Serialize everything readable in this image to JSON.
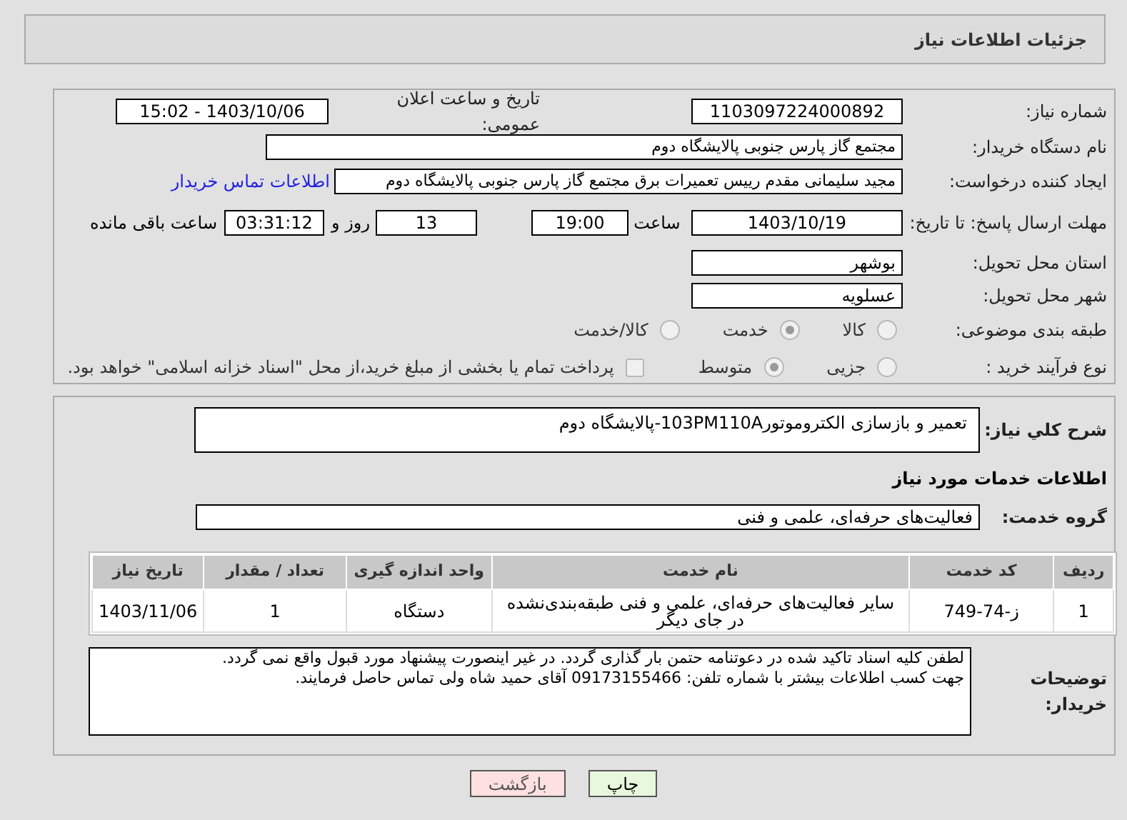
{
  "page_title": "جزئیات اطلاعات نیاز",
  "need_number": {
    "label": "شماره نیاز:",
    "value": "1103097224000892"
  },
  "announce": {
    "label": "تاریخ و ساعت اعلان عمومی:",
    "value": "1403/10/06 - 15:02"
  },
  "buyer": {
    "label": "نام دستگاه خریدار:",
    "value": "مجتمع گاز پارس جنوبی  پالایشگاه دوم"
  },
  "requester": {
    "label": "ایجاد کننده درخواست:",
    "value": "مجید سلیمانی مقدم رییس تعمیرات برق مجتمع گاز پارس جنوبی  پالایشگاه دوم",
    "link": "اطلاعات تماس خریدار"
  },
  "deadline": {
    "label": "مهلت ارسال پاسخ: تا تاریخ:",
    "date": "1403/10/19",
    "time_label": "ساعت",
    "time": "19:00",
    "days": "13",
    "days_label": "روز و",
    "remaining": "03:31:12",
    "remaining_label": "ساعت باقی مانده"
  },
  "province": {
    "label": "استان محل تحویل:",
    "value": "بوشهر"
  },
  "city": {
    "label": "شهر محل تحویل:",
    "value": "عسلویه"
  },
  "category": {
    "label": "طبقه بندی موضوعی:",
    "options": [
      {
        "label": "کالا",
        "selected": false
      },
      {
        "label": "خدمت",
        "selected": true
      },
      {
        "label": "کالا/خدمت",
        "selected": false
      }
    ]
  },
  "purchase_type": {
    "label": "نوع فرآیند خرید :",
    "options": [
      {
        "label": "جزیی",
        "selected": false
      },
      {
        "label": "متوسط",
        "selected": true
      }
    ],
    "payment": {
      "checked": false,
      "text": "پرداخت تمام یا بخشی از مبلغ خرید،از محل \"اسناد خزانه اسلامی\" خواهد بود."
    }
  },
  "description": {
    "label": "شرح کلي نياز:",
    "value": "تعمیر و بازسازی الکتروموتور103PM110A-پالایشگاه دوم"
  },
  "services_heading": "اطلاعات خدمات مورد نیاز",
  "service_group": {
    "label": "گروه خدمت:",
    "value": "فعالیت‌های حرفه‌ای، علمی و فنی"
  },
  "table": {
    "columns": [
      "ردیف",
      "کد خدمت",
      "نام خدمت",
      "واحد اندازه گیری",
      "تعداد / مقدار",
      "تاریخ نیاز"
    ],
    "rows": [
      [
        "1",
        "ز-74-749",
        "سایر فعالیت‌های حرفه‌ای، علمی و فنی طبقه‌بندی‌نشده در جای دیگر",
        "دستگاه",
        "1",
        "1403/11/06"
      ]
    ]
  },
  "buyer_notes": {
    "label": "توضیحات خریدار:",
    "value": "لطفن کلیه اسناد تاکید شده در دعوتنامه حتمن بار گذاری گردد. در غیر اینصورت پیشنهاد مورد قبول واقع نمی گردد.\nجهت کسب اطلاعات بیشتر با شماره تلفن: 09173155466 آقای حمید شاه ولی تماس حاصل فرمایند."
  },
  "buttons": [
    {
      "label": "چاپ",
      "kind": "print"
    },
    {
      "label": "بازگشت",
      "kind": "back"
    }
  ]
}
